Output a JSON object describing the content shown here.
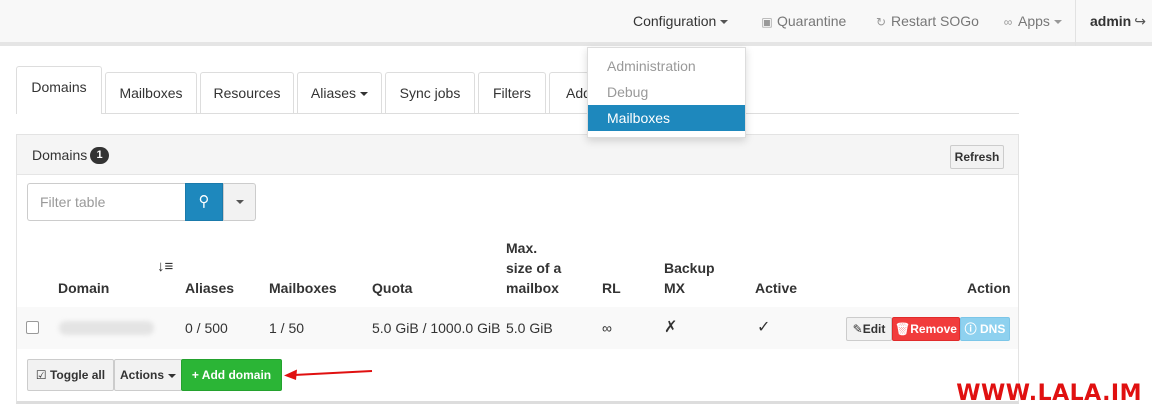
{
  "navbar": {
    "configuration": "Configuration",
    "quarantine": "Quarantine",
    "restart_sogo": "Restart SOGo",
    "apps": "Apps",
    "admin": "admin"
  },
  "config_menu": {
    "items": [
      "Administration",
      "Debug",
      "Mailboxes"
    ],
    "active": "Mailboxes"
  },
  "tabs": [
    "Domains",
    "Mailboxes",
    "Resources",
    "Aliases",
    "Sync jobs",
    "Filters",
    "Add"
  ],
  "panel": {
    "title": "Domains",
    "count": "1",
    "refresh": "Refresh"
  },
  "filter": {
    "placeholder": "Filter table"
  },
  "table": {
    "headers": {
      "domain": "Domain",
      "aliases": "Aliases",
      "mailboxes": "Mailboxes",
      "quota": "Quota",
      "max_size_1": "Max.",
      "max_size_2": "size of a",
      "max_size_3": "mailbox",
      "rl": "RL",
      "backup_1": "Backup",
      "backup_2": "MX",
      "active": "Active",
      "action": "Action"
    },
    "rows": [
      {
        "aliases": "0 / 500",
        "mailboxes": "1 / 50",
        "quota": "5.0 GiB / 1000.0 GiB",
        "max_size": "5.0 GiB",
        "rl": "∞",
        "backup_mx": "✗",
        "active": "✓",
        "edit": "Edit",
        "remove": "Remove",
        "dns": "DNS"
      }
    ]
  },
  "bottom": {
    "toggle_all": "Toggle all",
    "actions": "Actions",
    "add_domain": "Add domain"
  },
  "watermark": "WWW.LALA.IM",
  "colors": {
    "primary": "#1e88bd",
    "success": "#2bb536",
    "danger": "#f13c3c",
    "info": "#8ed1ef",
    "annotation": "#e01010"
  }
}
